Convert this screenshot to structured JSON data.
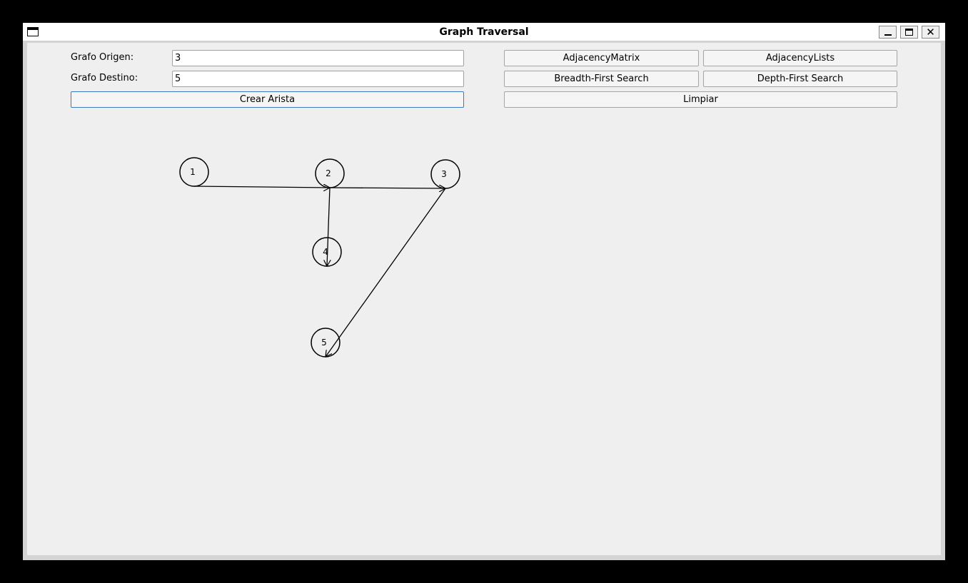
{
  "window": {
    "title": "Graph Traversal"
  },
  "form": {
    "origen_label": "Grafo Origen:",
    "origen_value": "3",
    "destino_label": "Grafo Destino:",
    "destino_value": "5",
    "crear_label": "Crear Arista"
  },
  "actions": {
    "adjacency_matrix": "AdjacencyMatrix",
    "adjacency_lists": "AdjacencyLists",
    "bfs": "Breadth-First Search",
    "dfs": "Depth-First Search",
    "limpiar": "Limpiar"
  },
  "graph": {
    "nodes": [
      {
        "label": "1"
      },
      {
        "label": "2"
      },
      {
        "label": "3"
      },
      {
        "label": "4"
      },
      {
        "label": "5"
      }
    ],
    "edges": [
      {
        "from": "1",
        "to": "2"
      },
      {
        "from": "2",
        "to": "3"
      },
      {
        "from": "2",
        "to": "4"
      },
      {
        "from": "3",
        "to": "5"
      }
    ]
  }
}
